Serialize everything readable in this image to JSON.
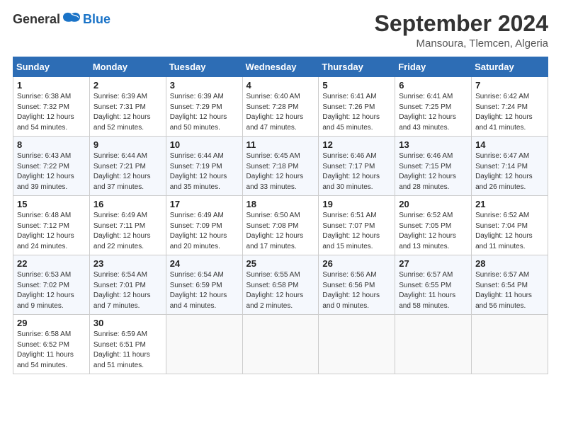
{
  "header": {
    "logo_general": "General",
    "logo_blue": "Blue",
    "title": "September 2024",
    "subtitle": "Mansoura, Tlemcen, Algeria"
  },
  "calendar": {
    "days_of_week": [
      "Sunday",
      "Monday",
      "Tuesday",
      "Wednesday",
      "Thursday",
      "Friday",
      "Saturday"
    ],
    "weeks": [
      [
        {
          "day": "1",
          "sunrise": "6:38 AM",
          "sunset": "7:32 PM",
          "daylight": "12 hours and 54 minutes."
        },
        {
          "day": "2",
          "sunrise": "6:39 AM",
          "sunset": "7:31 PM",
          "daylight": "12 hours and 52 minutes."
        },
        {
          "day": "3",
          "sunrise": "6:39 AM",
          "sunset": "7:29 PM",
          "daylight": "12 hours and 50 minutes."
        },
        {
          "day": "4",
          "sunrise": "6:40 AM",
          "sunset": "7:28 PM",
          "daylight": "12 hours and 47 minutes."
        },
        {
          "day": "5",
          "sunrise": "6:41 AM",
          "sunset": "7:26 PM",
          "daylight": "12 hours and 45 minutes."
        },
        {
          "day": "6",
          "sunrise": "6:41 AM",
          "sunset": "7:25 PM",
          "daylight": "12 hours and 43 minutes."
        },
        {
          "day": "7",
          "sunrise": "6:42 AM",
          "sunset": "7:24 PM",
          "daylight": "12 hours and 41 minutes."
        }
      ],
      [
        {
          "day": "8",
          "sunrise": "6:43 AM",
          "sunset": "7:22 PM",
          "daylight": "12 hours and 39 minutes."
        },
        {
          "day": "9",
          "sunrise": "6:44 AM",
          "sunset": "7:21 PM",
          "daylight": "12 hours and 37 minutes."
        },
        {
          "day": "10",
          "sunrise": "6:44 AM",
          "sunset": "7:19 PM",
          "daylight": "12 hours and 35 minutes."
        },
        {
          "day": "11",
          "sunrise": "6:45 AM",
          "sunset": "7:18 PM",
          "daylight": "12 hours and 33 minutes."
        },
        {
          "day": "12",
          "sunrise": "6:46 AM",
          "sunset": "7:17 PM",
          "daylight": "12 hours and 30 minutes."
        },
        {
          "day": "13",
          "sunrise": "6:46 AM",
          "sunset": "7:15 PM",
          "daylight": "12 hours and 28 minutes."
        },
        {
          "day": "14",
          "sunrise": "6:47 AM",
          "sunset": "7:14 PM",
          "daylight": "12 hours and 26 minutes."
        }
      ],
      [
        {
          "day": "15",
          "sunrise": "6:48 AM",
          "sunset": "7:12 PM",
          "daylight": "12 hours and 24 minutes."
        },
        {
          "day": "16",
          "sunrise": "6:49 AM",
          "sunset": "7:11 PM",
          "daylight": "12 hours and 22 minutes."
        },
        {
          "day": "17",
          "sunrise": "6:49 AM",
          "sunset": "7:09 PM",
          "daylight": "12 hours and 20 minutes."
        },
        {
          "day": "18",
          "sunrise": "6:50 AM",
          "sunset": "7:08 PM",
          "daylight": "12 hours and 17 minutes."
        },
        {
          "day": "19",
          "sunrise": "6:51 AM",
          "sunset": "7:07 PM",
          "daylight": "12 hours and 15 minutes."
        },
        {
          "day": "20",
          "sunrise": "6:52 AM",
          "sunset": "7:05 PM",
          "daylight": "12 hours and 13 minutes."
        },
        {
          "day": "21",
          "sunrise": "6:52 AM",
          "sunset": "7:04 PM",
          "daylight": "12 hours and 11 minutes."
        }
      ],
      [
        {
          "day": "22",
          "sunrise": "6:53 AM",
          "sunset": "7:02 PM",
          "daylight": "12 hours and 9 minutes."
        },
        {
          "day": "23",
          "sunrise": "6:54 AM",
          "sunset": "7:01 PM",
          "daylight": "12 hours and 7 minutes."
        },
        {
          "day": "24",
          "sunrise": "6:54 AM",
          "sunset": "6:59 PM",
          "daylight": "12 hours and 4 minutes."
        },
        {
          "day": "25",
          "sunrise": "6:55 AM",
          "sunset": "6:58 PM",
          "daylight": "12 hours and 2 minutes."
        },
        {
          "day": "26",
          "sunrise": "6:56 AM",
          "sunset": "6:56 PM",
          "daylight": "12 hours and 0 minutes."
        },
        {
          "day": "27",
          "sunrise": "6:57 AM",
          "sunset": "6:55 PM",
          "daylight": "11 hours and 58 minutes."
        },
        {
          "day": "28",
          "sunrise": "6:57 AM",
          "sunset": "6:54 PM",
          "daylight": "11 hours and 56 minutes."
        }
      ],
      [
        {
          "day": "29",
          "sunrise": "6:58 AM",
          "sunset": "6:52 PM",
          "daylight": "11 hours and 54 minutes."
        },
        {
          "day": "30",
          "sunrise": "6:59 AM",
          "sunset": "6:51 PM",
          "daylight": "11 hours and 51 minutes."
        },
        null,
        null,
        null,
        null,
        null
      ]
    ]
  }
}
